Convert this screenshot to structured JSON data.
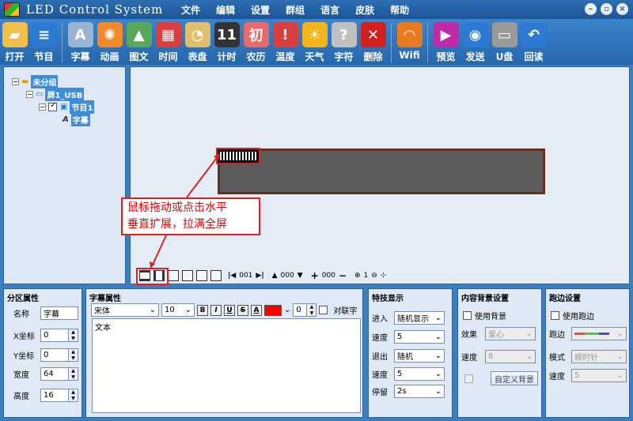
{
  "window": {
    "title": "LED Control System"
  },
  "menu": [
    "文件",
    "编辑",
    "设置",
    "群组",
    "语言",
    "皮肤",
    "帮助"
  ],
  "window_buttons": [
    "minimize-icon",
    "restore-icon",
    "close-icon"
  ],
  "toolbar": [
    {
      "label": "打开",
      "icon": "folder-open-icon",
      "color": "#f1c04a"
    },
    {
      "label": "节目",
      "icon": "program-icon",
      "color": "#2d7ad4"
    },
    {
      "label": "字幕",
      "icon": "subtitle-icon",
      "color": "#9ab4d6"
    },
    {
      "label": "动画",
      "icon": "animation-icon",
      "color": "#f08a2a"
    },
    {
      "label": "图文",
      "icon": "image-text-icon",
      "color": "#58a85c"
    },
    {
      "label": "时间",
      "icon": "calendar-icon",
      "color": "#d84040"
    },
    {
      "label": "表盘",
      "icon": "clock-icon",
      "color": "#e0c070"
    },
    {
      "label": "计时",
      "icon": "timer-icon",
      "color": "#333333"
    },
    {
      "label": "农历",
      "icon": "lunar-calendar-icon",
      "color": "#e86a6a"
    },
    {
      "label": "温度",
      "icon": "thermometer-icon",
      "color": "#d84040"
    },
    {
      "label": "天气",
      "icon": "sun-icon",
      "color": "#f4b41a"
    },
    {
      "label": "字符",
      "icon": "character-icon",
      "color": "#c0c0c0"
    },
    {
      "label": "删除",
      "icon": "delete-x-icon",
      "color": "#d02020"
    },
    {
      "label": "Wifi",
      "icon": "wifi-icon",
      "color": "#e87a20"
    },
    {
      "label": "预览",
      "icon": "play-icon",
      "color": "#c02aa8"
    },
    {
      "label": "发送",
      "icon": "globe-send-icon",
      "color": "#2d7ad4"
    },
    {
      "label": "U盘",
      "icon": "usb-icon",
      "color": "#9a9a9a"
    },
    {
      "label": "回读",
      "icon": "readback-icon",
      "color": "#2d7ad4"
    }
  ],
  "tree": {
    "group": "未分组",
    "screen": "屏1_USB",
    "program": "节目1",
    "item": "字幕"
  },
  "annotation": {
    "line1": "鼠标拖动或点击水平",
    "line2": "垂直扩展，拉满全屏"
  },
  "canvas_controls": {
    "page_value": "001",
    "align_value": "000",
    "zoom_value": "000",
    "scale_value": "1"
  },
  "colors": {
    "accent": "#3c8dde",
    "highlight": "#e02020",
    "led_bg": "#5c5c5c",
    "led_border": "#6a2c1c"
  },
  "zone_props": {
    "title": "分区属性",
    "name_label": "名称",
    "name_value": "字幕",
    "x_label": "X坐标",
    "x_value": "0",
    "y_label": "Y坐标",
    "y_value": "0",
    "width_label": "宽度",
    "width_value": "64",
    "height_label": "高度",
    "height_value": "16"
  },
  "subtitle_props": {
    "title": "字幕属性",
    "font": "宋体",
    "size": "10",
    "bold": "B",
    "italic": "I",
    "underline": "U",
    "strike": "S",
    "color_btn": "A",
    "spacing": "0",
    "align_label": "对联字",
    "text": "文本"
  },
  "effects": {
    "title": "特技显示",
    "enter_label": "进入",
    "enter_value": "随机显示",
    "speed1_label": "速度",
    "speed1_value": "5",
    "exit_label": "退出",
    "exit_value": "随机",
    "speed2_label": "速度",
    "speed2_value": "5",
    "stay_label": "停留",
    "stay_value": "2s"
  },
  "background": {
    "title": "内容背景设置",
    "use_label": "使用背景",
    "effect_label": "效果",
    "effect_value": "爱心",
    "speed_label": "速度",
    "speed_value": "8",
    "custom_button": "自定义背景"
  },
  "border": {
    "title": "跑边设置",
    "use_label": "使用跑边",
    "border_label": "跑边",
    "mode_label": "模式",
    "mode_value": "顺时针",
    "speed_label": "速度",
    "speed_value": "5"
  }
}
